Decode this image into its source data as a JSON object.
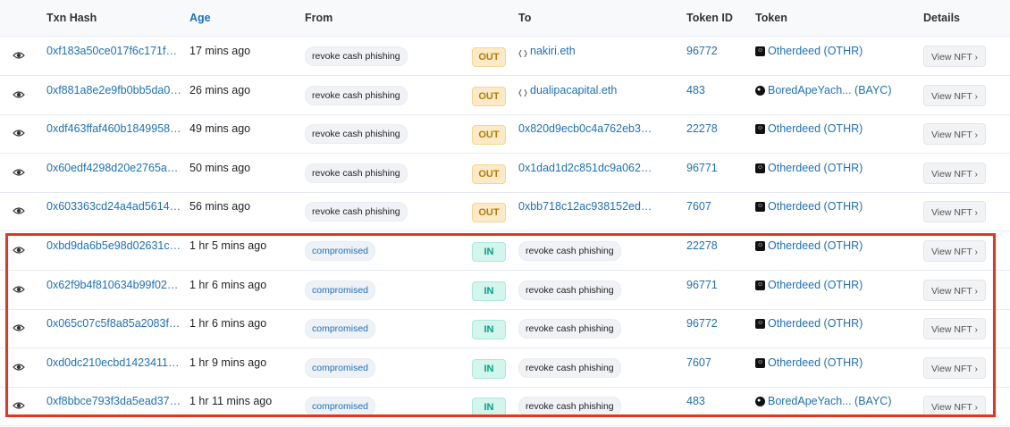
{
  "headers": {
    "txn_hash": "Txn Hash",
    "age": "Age",
    "from": "From",
    "to": "To",
    "token_id": "Token ID",
    "token": "Token",
    "details": "Details"
  },
  "colors": {
    "link": "#1e70b8",
    "out_bg": "#fbe9c8",
    "in_bg": "#d4f5ec",
    "highlight": "#e8331e"
  },
  "rows": [
    {
      "hash": "0xf183a50ce017f6c171f…",
      "age": "17 mins ago",
      "from": "revoke cash phishing",
      "from_type": "tag",
      "dir": "OUT",
      "to": "nakiri.eth",
      "to_type": "ens",
      "token_id": "96772",
      "token": "Otherdeed (OTHR)",
      "token_icon": "otherdeed-icon",
      "details": "View NFT ›"
    },
    {
      "hash": "0xf881a8e2e9fb0bb5da0…",
      "age": "26 mins ago",
      "from": "revoke cash phishing",
      "from_type": "tag",
      "dir": "OUT",
      "to": "dualipacapital.eth",
      "to_type": "ens",
      "token_id": "483",
      "token": "BoredApeYach... (BAYC)",
      "token_icon": "bayc-icon",
      "details": "View NFT ›"
    },
    {
      "hash": "0xdf463ffaf460b1849958…",
      "age": "49 mins ago",
      "from": "revoke cash phishing",
      "from_type": "tag",
      "dir": "OUT",
      "to": "0x820d9ecb0c4a762eb3…",
      "to_type": "addr",
      "token_id": "22278",
      "token": "Otherdeed (OTHR)",
      "token_icon": "otherdeed-icon",
      "details": "View NFT ›"
    },
    {
      "hash": "0x60edf4298d20e2765a…",
      "age": "50 mins ago",
      "from": "revoke cash phishing",
      "from_type": "tag",
      "dir": "OUT",
      "to": "0x1dad1d2c851dc9a062…",
      "to_type": "addr",
      "token_id": "96771",
      "token": "Otherdeed (OTHR)",
      "token_icon": "otherdeed-icon",
      "details": "View NFT ›"
    },
    {
      "hash": "0x603363cd24a4ad5614…",
      "age": "56 mins ago",
      "from": "revoke cash phishing",
      "from_type": "tag",
      "dir": "OUT",
      "to": "0xbb718c12ac938152ed…",
      "to_type": "addr",
      "token_id": "7607",
      "token": "Otherdeed (OTHR)",
      "token_icon": "otherdeed-icon",
      "details": "View NFT ›"
    },
    {
      "hash": "0xbd9da6b5e98d02631c…",
      "age": "1 hr 5 mins ago",
      "from": "compromised",
      "from_type": "comp",
      "dir": "IN",
      "to": "revoke cash phishing",
      "to_type": "tag",
      "token_id": "22278",
      "token": "Otherdeed (OTHR)",
      "token_icon": "otherdeed-icon",
      "details": "View NFT ›"
    },
    {
      "hash": "0x62f9b4f810634b99f02…",
      "age": "1 hr 6 mins ago",
      "from": "compromised",
      "from_type": "comp",
      "dir": "IN",
      "to": "revoke cash phishing",
      "to_type": "tag",
      "token_id": "96771",
      "token": "Otherdeed (OTHR)",
      "token_icon": "otherdeed-icon",
      "details": "View NFT ›"
    },
    {
      "hash": "0x065c07c5f8a85a2083f…",
      "age": "1 hr 6 mins ago",
      "from": "compromised",
      "from_type": "comp",
      "dir": "IN",
      "to": "revoke cash phishing",
      "to_type": "tag",
      "token_id": "96772",
      "token": "Otherdeed (OTHR)",
      "token_icon": "otherdeed-icon",
      "details": "View NFT ›"
    },
    {
      "hash": "0xd0dc210ecbd1423411…",
      "age": "1 hr 9 mins ago",
      "from": "compromised",
      "from_type": "comp",
      "dir": "IN",
      "to": "revoke cash phishing",
      "to_type": "tag",
      "token_id": "7607",
      "token": "Otherdeed (OTHR)",
      "token_icon": "otherdeed-icon",
      "details": "View NFT ›"
    },
    {
      "hash": "0xf8bbce793f3da5ead37…",
      "age": "1 hr 11 mins ago",
      "from": "compromised",
      "from_type": "comp",
      "dir": "IN",
      "to": "revoke cash phishing",
      "to_type": "tag",
      "token_id": "483",
      "token": "BoredApeYach... (BAYC)",
      "token_icon": "bayc-icon",
      "details": "View NFT ›"
    }
  ]
}
